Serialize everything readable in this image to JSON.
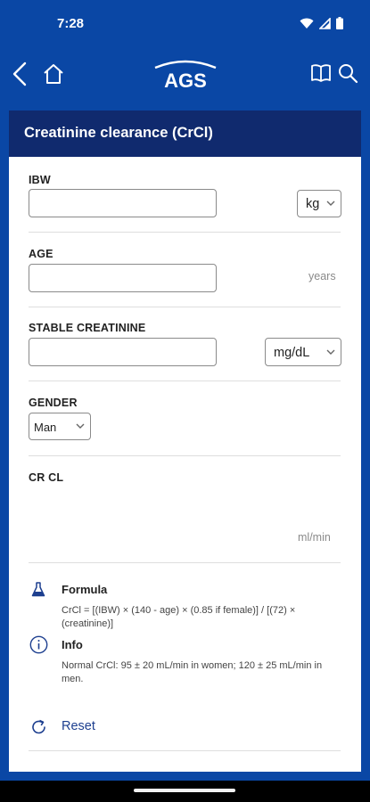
{
  "status": {
    "time": "7:28"
  },
  "app": {
    "logo_text": "AGS"
  },
  "panel": {
    "title": "Creatinine clearance (CrCl)"
  },
  "fields": {
    "ibw": {
      "label": "IBW",
      "value": "",
      "unit_option": "kg"
    },
    "age": {
      "label": "AGE",
      "value": "",
      "unit": "years"
    },
    "creatinine": {
      "label": "STABLE CREATININE",
      "value": "",
      "unit_option": "mg/dL"
    },
    "gender": {
      "label": "GENDER",
      "selected": "Man"
    },
    "result": {
      "label": "CR CL",
      "unit": "ml/min"
    }
  },
  "formula": {
    "title": "Formula",
    "text": "CrCl = [(IBW) × (140 - age) × (0.85 if female)] / [(72) × (creatinine)]"
  },
  "info": {
    "title": "Info",
    "text": "Normal CrCl: 95 ± 20 mL/min in women; 120 ± 25 mL/min in men."
  },
  "actions": {
    "reset_label": "Reset"
  },
  "icons": {
    "back": "chevron-left-icon",
    "home": "home-icon",
    "book": "book-icon",
    "search": "search-icon",
    "formula": "flask-icon",
    "info": "info-circle-icon",
    "reset": "refresh-icon"
  },
  "colors": {
    "primary": "#0a47a5",
    "header_dark": "#102a6e",
    "link": "#1d3f8f"
  }
}
